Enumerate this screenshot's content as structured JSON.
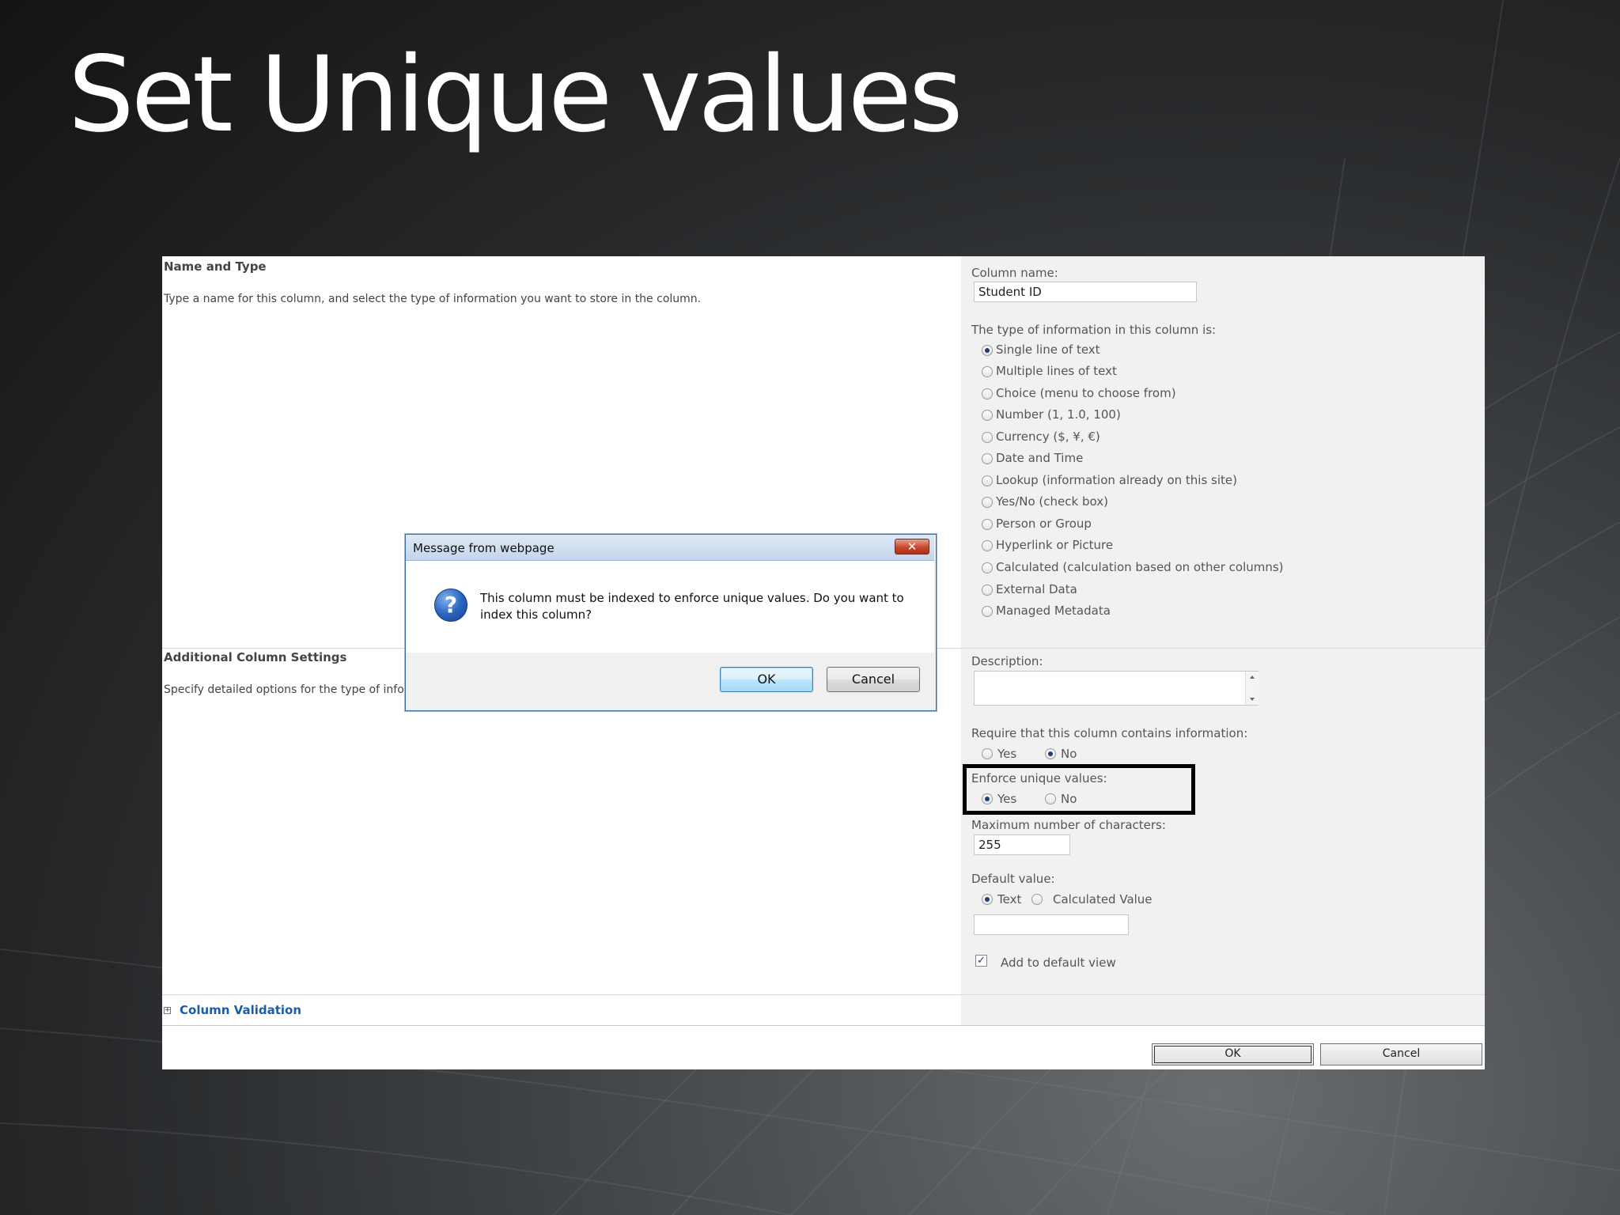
{
  "slide": {
    "title": "Set Unique values"
  },
  "name_and_type": {
    "title": "Name and Type",
    "description": "Type a name for this column, and select the type of information you want to store in the column."
  },
  "column_name": {
    "label": "Column name:",
    "value": "Student ID"
  },
  "type_section": {
    "label": "The type of information in this column is:",
    "options": [
      "Single line of text",
      "Multiple lines of text",
      "Choice (menu to choose from)",
      "Number (1, 1.0, 100)",
      "Currency ($, ¥, €)",
      "Date and Time",
      "Lookup (information already on this site)",
      "Yes/No (check box)",
      "Person or Group",
      "Hyperlink or Picture",
      "Calculated (calculation based on other columns)",
      "External Data",
      "Managed Metadata"
    ],
    "selected": "Single line of text"
  },
  "additional": {
    "title": "Additional Column Settings",
    "description": "Specify detailed options for the type of inform"
  },
  "description_field": {
    "label": "Description:",
    "value": ""
  },
  "require": {
    "label": "Require that this column contains information:",
    "yes": "Yes",
    "no": "No",
    "selected": "No"
  },
  "enforce": {
    "label": "Enforce unique values:",
    "yes": "Yes",
    "no": "No",
    "selected": "Yes"
  },
  "max_chars": {
    "label": "Maximum number of characters:",
    "value": "255"
  },
  "default_value": {
    "label": "Default value:",
    "text": "Text",
    "calculated": "Calculated Value",
    "selected": "Text",
    "value": ""
  },
  "add_default_view": {
    "label": "Add to default view",
    "checked": true
  },
  "column_validation": {
    "label": "Column Validation",
    "expand_glyph": "+"
  },
  "footer": {
    "ok": "OK",
    "cancel": "Cancel"
  },
  "dialog": {
    "title": "Message from webpage",
    "close_glyph": "✕",
    "message": "This column must be indexed to enforce unique values. Do you want to index this column?",
    "icon_glyph": "?",
    "ok": "OK",
    "cancel": "Cancel"
  },
  "colors": {
    "link": "#1a5ea8",
    "radio_dot": "#1d3f74",
    "dialog_border": "#3a6ea5"
  }
}
